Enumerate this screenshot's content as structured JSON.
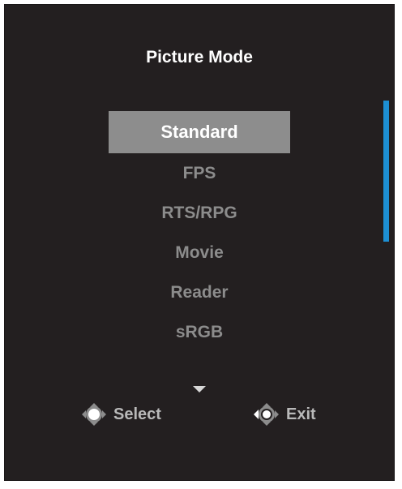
{
  "osd": {
    "title": "Picture Mode",
    "items": [
      {
        "label": "Standard",
        "selected": true
      },
      {
        "label": "FPS",
        "selected": false
      },
      {
        "label": "RTS/RPG",
        "selected": false
      },
      {
        "label": "Movie",
        "selected": false
      },
      {
        "label": "Reader",
        "selected": false
      },
      {
        "label": "sRGB",
        "selected": false
      }
    ],
    "hints": {
      "select_label": "Select",
      "exit_label": "Exit"
    },
    "icons": {
      "more_indicator": "chevron-down-icon",
      "select_icon": "joystick-press-icon",
      "exit_icon": "joystick-left-icon"
    },
    "colors": {
      "background": "#231f20",
      "selected_bg": "#8d8d8d",
      "scrollbar": "#1d8fd3",
      "text_dim": "#8c8c8c"
    }
  }
}
